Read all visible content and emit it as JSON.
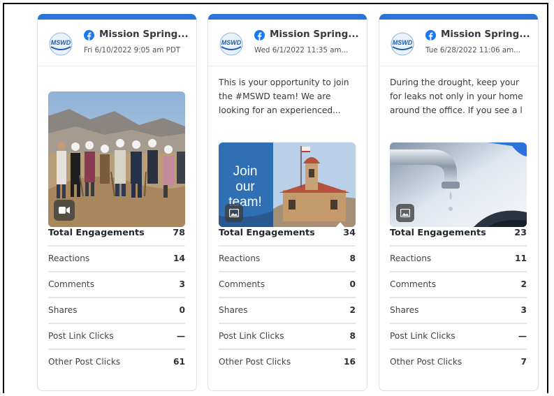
{
  "posts": [
    {
      "page_name": "Mission Spring...",
      "date": "Fri 6/10/2022 9:05 am PDT",
      "caption_lines": [],
      "media_type": "video",
      "stats": [
        {
          "label": "Total Engagements",
          "value": "78"
        },
        {
          "label": "Reactions",
          "value": "14"
        },
        {
          "label": "Comments",
          "value": "3"
        },
        {
          "label": "Shares",
          "value": "0"
        },
        {
          "label": "Post Link Clicks",
          "value": "—"
        },
        {
          "label": "Other Post Clicks",
          "value": "61"
        }
      ]
    },
    {
      "page_name": "Mission Spring...",
      "date": "Wed 6/1/2022 11:35 am...",
      "caption_lines": [
        "This is your opportunity to join",
        "the #MSWD team! We are",
        "looking for an experienced..."
      ],
      "media_type": "image",
      "media_text": [
        "Join",
        "our",
        "team!"
      ],
      "stats": [
        {
          "label": "Total Engagements",
          "value": "34"
        },
        {
          "label": "Reactions",
          "value": "8"
        },
        {
          "label": "Comments",
          "value": "0"
        },
        {
          "label": "Shares",
          "value": "2"
        },
        {
          "label": "Post Link Clicks",
          "value": "8"
        },
        {
          "label": "Other Post Clicks",
          "value": "16"
        }
      ]
    },
    {
      "page_name": "Mission Spring...",
      "date": "Tue 6/28/2022 11:06 am...",
      "caption_lines": [
        "During the drought, keep your",
        "for leaks not only in your home",
        "around the office. If you see a l"
      ],
      "media_type": "image",
      "stats": [
        {
          "label": "Total Engagements",
          "value": "23"
        },
        {
          "label": "Reactions",
          "value": "11"
        },
        {
          "label": "Comments",
          "value": "2"
        },
        {
          "label": "Shares",
          "value": "3"
        },
        {
          "label": "Post Link Clicks",
          "value": "—"
        },
        {
          "label": "Other Post Clicks",
          "value": "7"
        }
      ]
    }
  ],
  "logo_text": "MSWD",
  "colors": {
    "accent_bar": "#2b73d9",
    "facebook_blue": "#1877f2",
    "logo_blue": "#1f5fae"
  },
  "icons": {
    "network": "facebook-icon",
    "video_badge": "video-camera-icon",
    "image_badge": "image-icon"
  }
}
